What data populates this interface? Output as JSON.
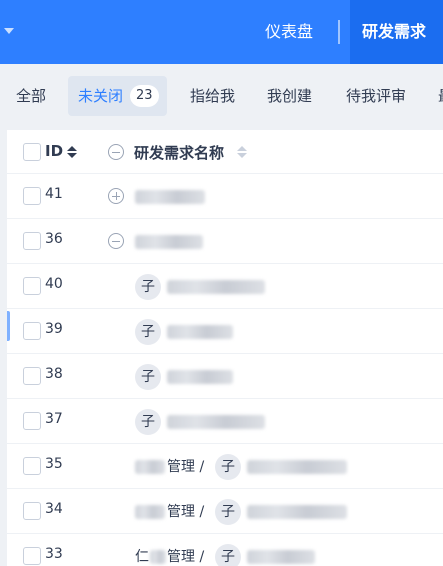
{
  "topnav": {
    "items": [
      {
        "label": "仪表盘"
      },
      {
        "label": "研发需求"
      }
    ]
  },
  "tabs": [
    {
      "label": "全部"
    },
    {
      "label": "未关闭",
      "count": "23"
    },
    {
      "label": "指给我"
    },
    {
      "label": "我创建"
    },
    {
      "label": "待我评审"
    },
    {
      "label": "最"
    }
  ],
  "table": {
    "columns": [
      {
        "label": "ID"
      },
      {
        "label": "研发需求名称"
      }
    ],
    "rows": [
      {
        "id": "41",
        "kind": "parent-collapsed"
      },
      {
        "id": "36",
        "kind": "parent-expanded"
      },
      {
        "id": "40",
        "kind": "child",
        "badge": "子"
      },
      {
        "id": "39",
        "kind": "child",
        "badge": "子"
      },
      {
        "id": "38",
        "kind": "child",
        "badge": "子"
      },
      {
        "id": "37",
        "kind": "child",
        "badge": "子"
      },
      {
        "id": "35",
        "kind": "child-with-path",
        "path_text": "管理 /",
        "badge": "子"
      },
      {
        "id": "34",
        "kind": "child-with-path",
        "path_text": "管理 /",
        "badge": "子"
      },
      {
        "id": "33",
        "kind": "child-with-path",
        "path_prefix": "仁",
        "path_text": "管理 /",
        "badge": "子"
      }
    ]
  }
}
